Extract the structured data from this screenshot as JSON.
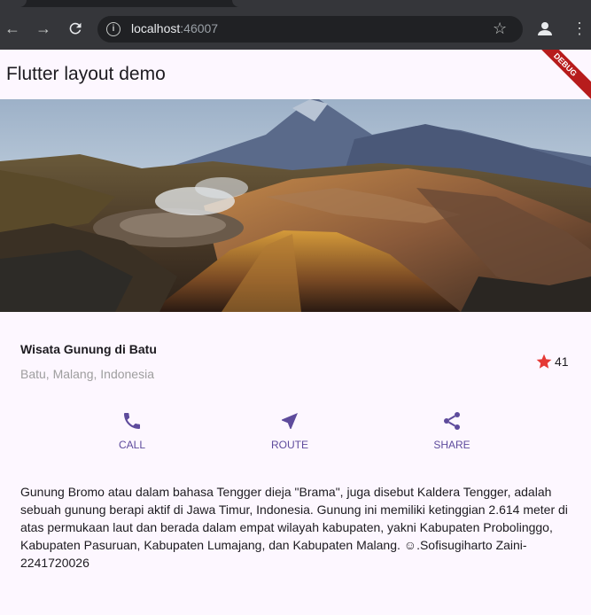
{
  "browser": {
    "url_host": "localhost",
    "url_port": ":46007"
  },
  "app": {
    "title": "Flutter layout demo",
    "debug_banner": "DEBUG"
  },
  "place": {
    "title": "Wisata Gunung di Batu",
    "location": "Batu, Malang, Indonesia",
    "rating_count": "41"
  },
  "actions": {
    "call": "CALL",
    "route": "ROUTE",
    "share": "SHARE"
  },
  "description": "Gunung Bromo atau dalam bahasa Tengger dieja \"Brama\", juga disebut Kaldera Tengger, adalah sebuah gunung berapi aktif di Jawa Timur, Indonesia. Gunung ini memiliki ketinggian 2.614 meter di atas permukaan laut dan berada dalam empat wilayah kabupaten, yakni Kabupaten Probolinggo, Kabupaten Pasuruan, Kabupaten Lumajang, dan Kabupaten Malang. ☺.Sofisugiharto Zaini-2241720026",
  "colors": {
    "accent": "#5e4b9c",
    "star": "#e53935",
    "background": "#fdf7ff"
  }
}
